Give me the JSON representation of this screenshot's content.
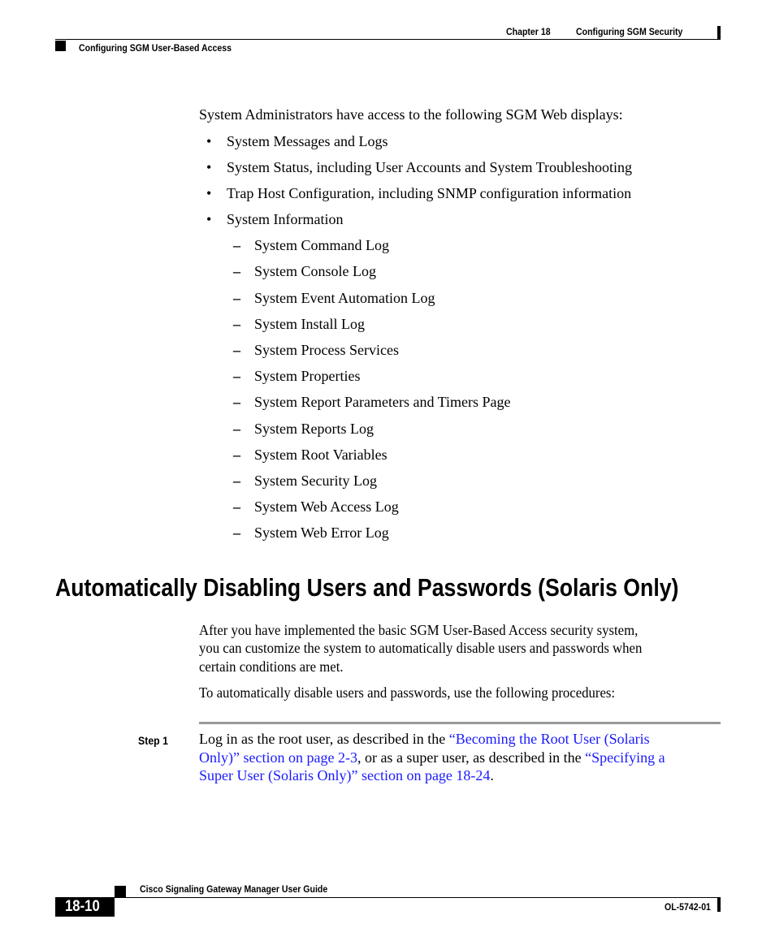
{
  "header": {
    "chapter_label": "Chapter 18",
    "chapter_title": "Configuring SGM Security",
    "section_title": "Configuring SGM User-Based Access"
  },
  "intro": "System Administrators have access to the following SGM Web displays:",
  "bullets": [
    "System Messages and Logs",
    "System Status, including User Accounts and System Troubleshooting",
    "Trap Host Configuration, including SNMP configuration information",
    "System Information"
  ],
  "sub_bullets": [
    "System Command Log",
    "System Console Log",
    "System Event Automation Log",
    "System Install Log",
    "System Process Services",
    "System Properties",
    "System Report Parameters and Timers Page",
    "System Reports Log",
    "System Root Variables",
    "System Security Log",
    "System Web Access Log",
    "System Web Error Log"
  ],
  "section_heading": "Automatically Disabling Users and Passwords (Solaris Only)",
  "para1_lines": [
    "After you have implemented the basic SGM User-Based Access security system,",
    "you can customize the system to automatically disable users and passwords when",
    "certain conditions are met."
  ],
  "para2": "To automatically disable users and passwords, use the following procedures:",
  "step": {
    "label": "Step 1",
    "line1_text": "Log in as the root user, as described in the ",
    "line1_link": "“Becoming the Root User (Solaris",
    "line2_link": "Only)” section on page 2-3",
    "line2_text": ", or as a super user, as described in the ",
    "line2_link2": "“Specifying a",
    "line3_link": "Super User (Solaris Only)” section on page 18-24",
    "line3_text": "."
  },
  "footer": {
    "guide_title": "Cisco Signaling Gateway Manager User Guide",
    "page_number": "18-10",
    "doc_number": "OL-5742-01"
  }
}
